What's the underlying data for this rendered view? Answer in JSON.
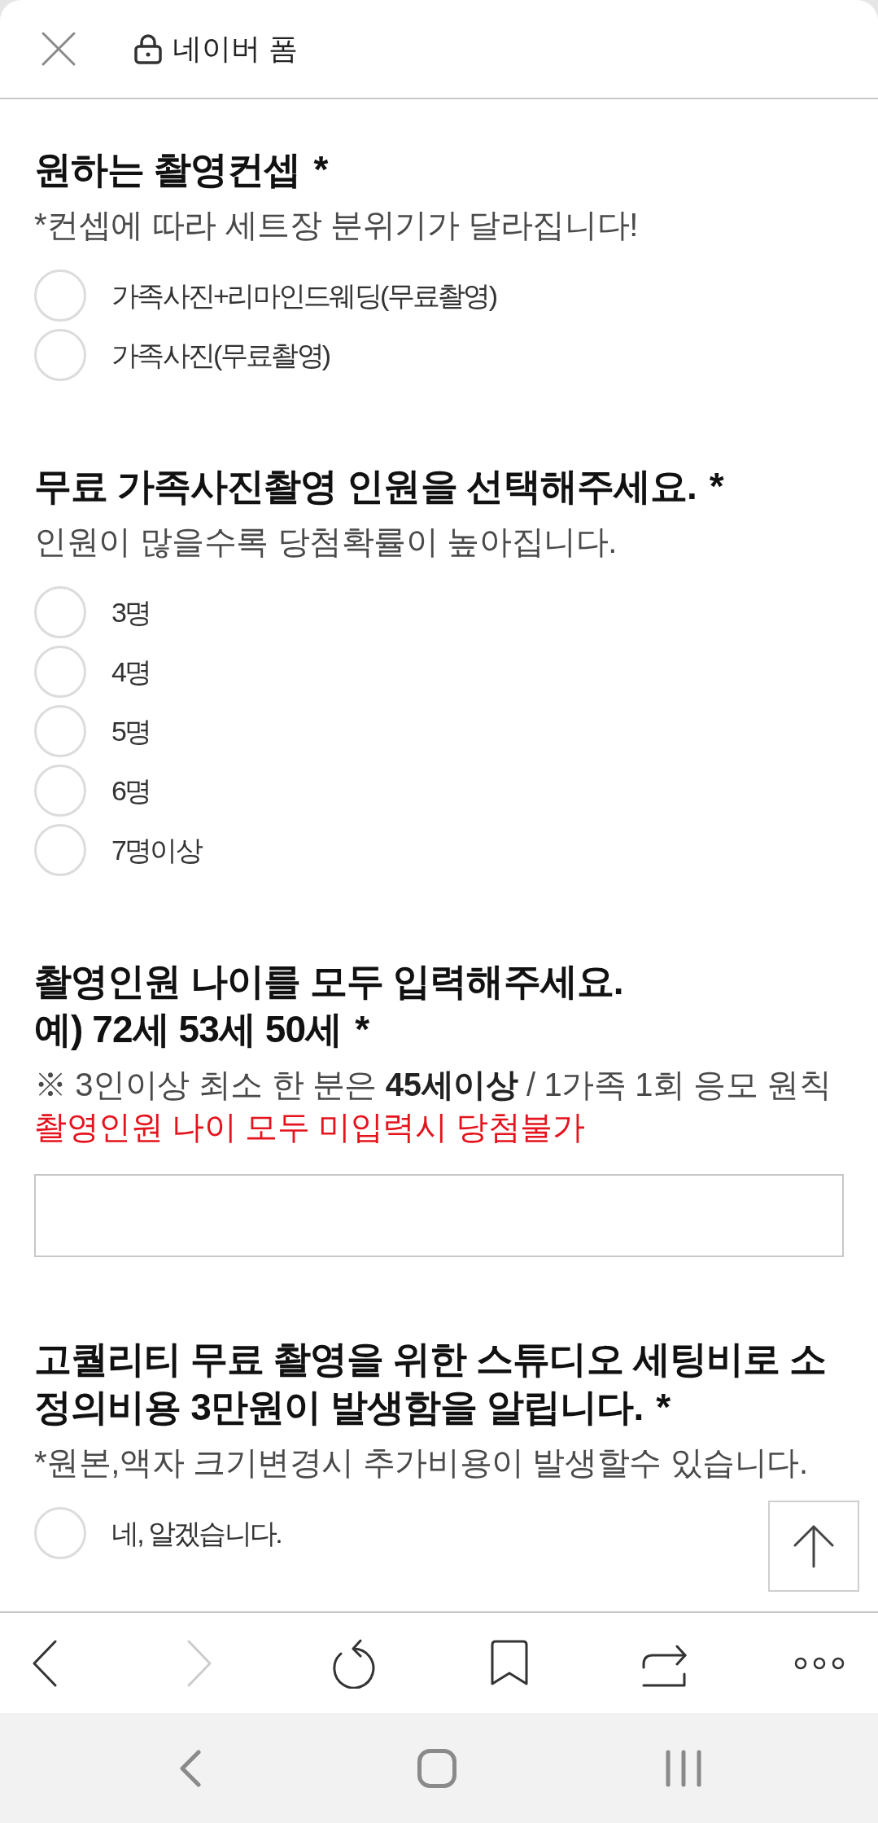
{
  "header": {
    "title": "네이버 폼"
  },
  "questions": [
    {
      "kind": "choice",
      "title_lines": [
        "원하는 촬영컨셉"
      ],
      "required_mark": "*",
      "descriptions": [
        {
          "kind": "note",
          "text": "*컨셉에 따라 세트장 분위기가 달라집니다!"
        }
      ],
      "options": [
        {
          "label": "가족사진+리마인드웨딩(무료촬영)",
          "selected": false
        },
        {
          "label": "가족사진(무료촬영)",
          "selected": false
        }
      ]
    },
    {
      "kind": "choice",
      "title_lines": [
        "무료 가족사진촬영 인원을 선택해주세요."
      ],
      "required_mark": "*",
      "descriptions": [
        {
          "kind": "note",
          "text": "인원이 많을수록 당첨확률이 높아집니다."
        }
      ],
      "options": [
        {
          "label": "3명",
          "selected": false
        },
        {
          "label": "4명",
          "selected": false
        },
        {
          "label": "5명",
          "selected": false
        },
        {
          "label": "6명",
          "selected": false
        },
        {
          "label": "7명이상",
          "selected": false
        }
      ]
    },
    {
      "kind": "text",
      "title_lines": [
        "촬영인원 나이를 모두 입력해주세요.",
        "예) 72세 53세 50세"
      ],
      "required_mark": "*",
      "descriptions": [
        {
          "kind": "note",
          "text": "※ 3인이상 최소 한 분은 **45세이상** / 1가족 1회 응모 원칙"
        },
        {
          "kind": "warning",
          "text": "촬영인원 나이 모두 미입력시 당첨불가"
        }
      ]
    },
    {
      "kind": "choice",
      "title_lines": [
        "고퀄리티 무료 촬영을 위한 스튜디오 세팅비로 소",
        "정의비용 3만원이 발생함을 알립니다."
      ],
      "required_mark": "*",
      "descriptions": [
        {
          "kind": "note",
          "text": "*원본,액자 크기변경시 추가비용이 발생할수 있습니다."
        }
      ],
      "options": [
        {
          "label": "네, 알겠습니다.",
          "selected": false
        }
      ]
    }
  ],
  "browser_toolbar": [
    {
      "kind": "back",
      "disabled": false
    },
    {
      "kind": "forward",
      "disabled": true
    },
    {
      "kind": "reload",
      "disabled": false
    },
    {
      "kind": "bookmark",
      "disabled": false
    },
    {
      "kind": "share",
      "disabled": false
    },
    {
      "kind": "more",
      "disabled": false
    }
  ]
}
